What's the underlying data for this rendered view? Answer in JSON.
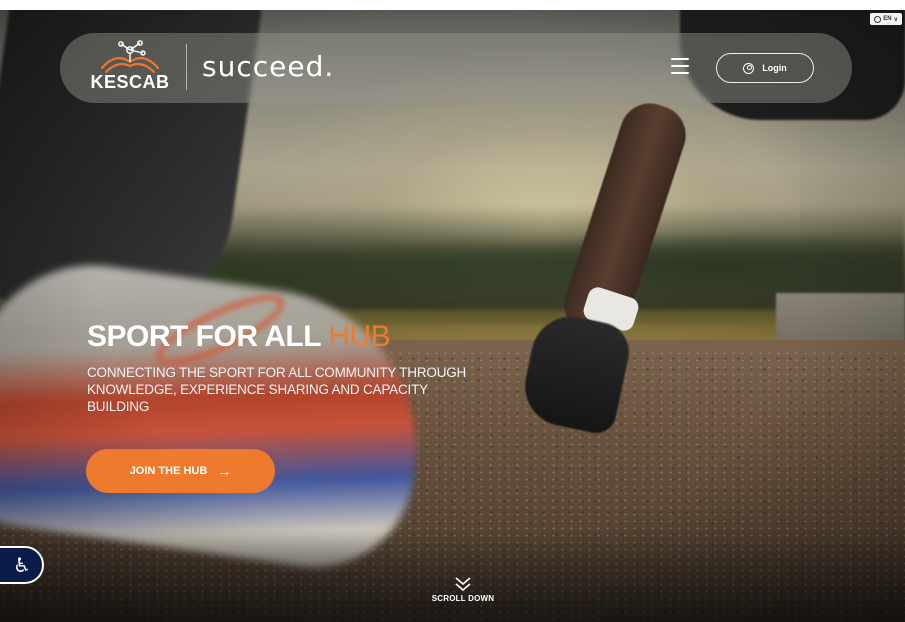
{
  "language": {
    "label": "EN",
    "icon": "globe-icon"
  },
  "header": {
    "logo_primary": "KESCAB",
    "logo_secondary": "succeed.",
    "menu_icon": "hamburger-menu-icon",
    "login_label": "Login",
    "login_icon": "user-circle-icon"
  },
  "hero": {
    "title_main": "SPORT FOR ALL",
    "title_accent": "HUB",
    "subtitle": "CONNECTING THE SPORT FOR ALL COMMUNITY THROUGH KNOWLEDGE, EXPERIENCE SHARING AND CAPACITY BUILDING",
    "cta_label": "JOIN THE HUB",
    "cta_icon": "arrow-right-icon"
  },
  "accessibility": {
    "icon": "accessibility-icon"
  },
  "scroll": {
    "label": "SCROLL DOWN",
    "icon": "chevron-double-down-icon"
  },
  "colors": {
    "accent": "#ee7a2e",
    "accessibility_bg": "#0b1c4a",
    "text": "#ffffff"
  }
}
